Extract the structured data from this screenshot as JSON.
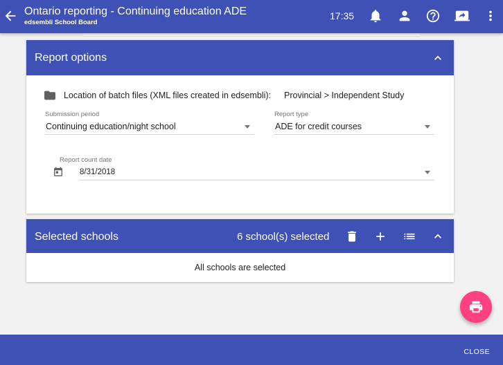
{
  "app": {
    "title": "Ontario reporting - Continuing education ADE",
    "subtitle": "edsembli School Board",
    "time": "17:35",
    "icons": [
      "back-arrow-icon",
      "bell-icon",
      "person-icon",
      "help-icon",
      "screen-share-icon",
      "more-vert-icon"
    ]
  },
  "report_options": {
    "header": "Report options",
    "location_label": "Location of batch files (XML files created in edsembli):",
    "location_value": "Provincial > Independent Study",
    "submission_period": {
      "label": "Submission period",
      "value": "Continuing education/night school"
    },
    "report_type": {
      "label": "Report type",
      "value": "ADE for credit courses"
    },
    "report_count_date": {
      "label": "Report count date",
      "value": "8/31/2018"
    }
  },
  "selected_schools": {
    "header": "Selected schools",
    "count_text": "6 school(s) selected",
    "note": "All schools are selected",
    "icons": [
      "delete-icon",
      "add-icon",
      "list-icon",
      "collapse-icon"
    ]
  },
  "footer": {
    "close_label": "CLOSE"
  },
  "colors": {
    "primary": "#3f51b5",
    "accent": "#ff4081",
    "background": "#f2f2f2"
  }
}
